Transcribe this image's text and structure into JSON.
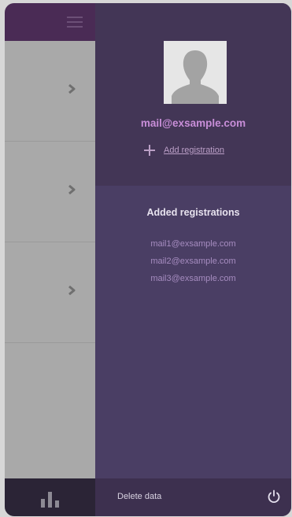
{
  "menu": {
    "icon": "hamburger-icon"
  },
  "list_rows": [
    {
      "icon": "chevron-right-icon"
    },
    {
      "icon": "chevron-right-icon"
    },
    {
      "icon": "chevron-right-icon"
    }
  ],
  "bottom_bar": {
    "stats_icon": "bar-chart-icon"
  },
  "profile": {
    "avatar_icon": "user-avatar-icon",
    "email": "mail@exsample.com",
    "add_icon": "plus-icon",
    "add_label": "Add registration"
  },
  "registrations": {
    "title": "Added registrations",
    "items": [
      "mail1@exsample.com",
      "mail2@exsample.com",
      "mail3@exsample.com"
    ]
  },
  "footer": {
    "delete_label": "Delete data",
    "power_icon": "power-icon"
  },
  "colors": {
    "accent": "#c88ed8",
    "drawer_bg": "#4a3e64",
    "header_bg": "#4a2b55"
  }
}
